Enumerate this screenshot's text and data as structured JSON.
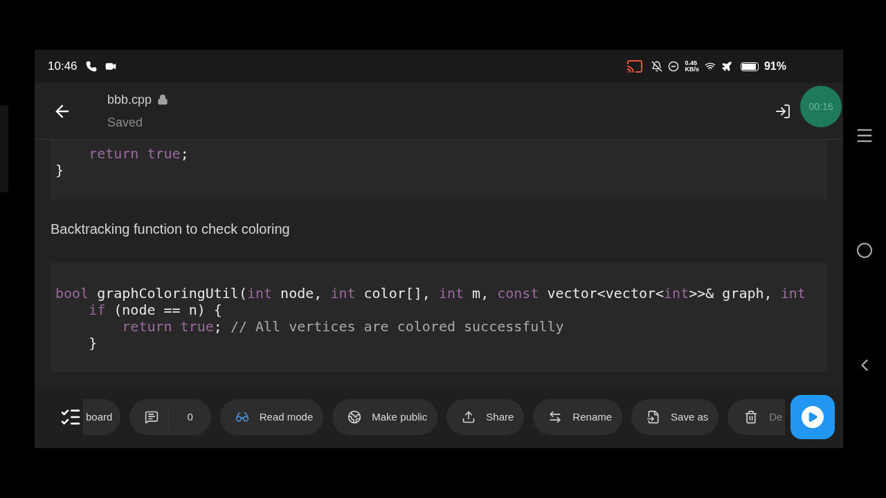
{
  "status_bar": {
    "time": "10:46",
    "network_speed": "0.45",
    "network_unit": "KB/s",
    "battery": "91%"
  },
  "header": {
    "file_name": "bbb.cpp",
    "locked": true,
    "status": "Saved"
  },
  "recording": {
    "time": "00:16"
  },
  "blocks": [
    {
      "kind": "code",
      "lines": [
        [
          {
            "text": "    return true",
            "kind": "keyword"
          },
          {
            "text": ";",
            "kind": "plain"
          }
        ],
        [
          {
            "text": "}",
            "kind": "plain"
          }
        ]
      ]
    },
    {
      "kind": "text",
      "text": "Backtracking function to check coloring"
    },
    {
      "kind": "code",
      "lines": [
        [
          {
            "text": "bool",
            "kind": "keyword"
          },
          {
            "text": " graphColoringUtil(",
            "kind": "plain"
          },
          {
            "text": "int",
            "kind": "keyword"
          },
          {
            "text": " node, ",
            "kind": "plain"
          },
          {
            "text": "int",
            "kind": "keyword"
          },
          {
            "text": " color[], ",
            "kind": "plain"
          },
          {
            "text": "int",
            "kind": "keyword"
          },
          {
            "text": " m, ",
            "kind": "plain"
          },
          {
            "text": "const",
            "kind": "keyword"
          },
          {
            "text": " vector<vector<",
            "kind": "plain"
          },
          {
            "text": "int",
            "kind": "keyword"
          },
          {
            "text": ">>& graph, ",
            "kind": "plain"
          },
          {
            "text": "int",
            "kind": "keyword"
          }
        ],
        [
          {
            "text": "    if",
            "kind": "keyword"
          },
          {
            "text": " (node == n) {",
            "kind": "plain"
          }
        ],
        [
          {
            "text": "        return true",
            "kind": "keyword"
          },
          {
            "text": "; ",
            "kind": "plain"
          },
          {
            "text": "// All vertices are colored successfully",
            "kind": "comment"
          }
        ],
        [
          {
            "text": "    }",
            "kind": "plain"
          }
        ]
      ]
    }
  ],
  "toolbar": [
    {
      "kind": "partial",
      "label": "board"
    },
    {
      "kind": "comments",
      "count": "0"
    },
    {
      "kind": "read",
      "label": "Read mode"
    },
    {
      "kind": "globe",
      "label": "Make public"
    },
    {
      "kind": "share",
      "label": "Share"
    },
    {
      "kind": "rename",
      "label": "Rename"
    },
    {
      "kind": "saveas",
      "label": "Save as"
    },
    {
      "kind": "delete",
      "label": "De"
    }
  ]
}
